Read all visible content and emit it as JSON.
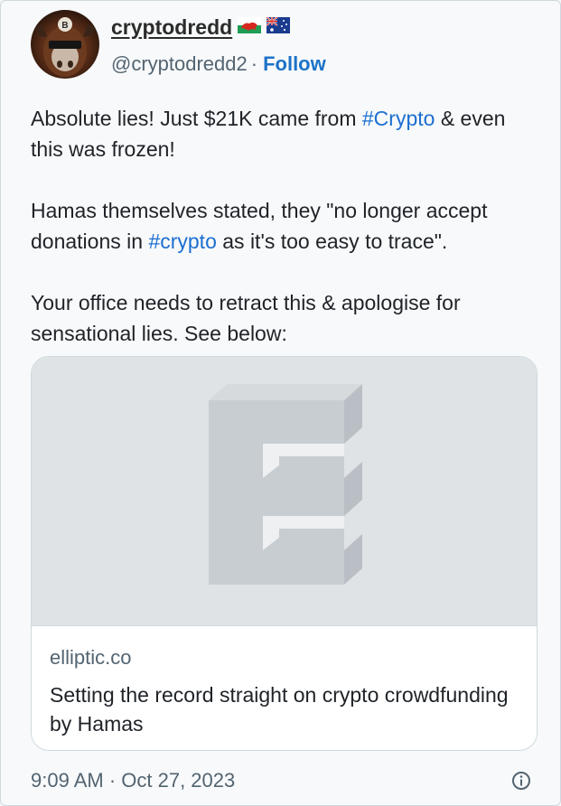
{
  "author": {
    "display_name": "cryptodredd",
    "handle": "@cryptodredd2",
    "separator": "·",
    "follow_label": "Follow",
    "flags": [
      "wales-flag-icon",
      "australia-flag-icon"
    ]
  },
  "tweet": {
    "p1_a": "Absolute lies!  Just $21K came from ",
    "p1_tag": "#Crypto",
    "p1_b": " & even this was frozen!",
    "p2_a": "Hamas themselves stated, they \"no longer accept donations in ",
    "p2_tag": "#crypto",
    "p2_b": " as it's too easy to trace\".",
    "p3": "Your office needs to retract this & apologise for sensational lies. See below:"
  },
  "card": {
    "domain": "elliptic.co",
    "title": "Setting the record straight on crypto crowdfunding by Hamas",
    "image_icon": "elliptic-logo-icon"
  },
  "timestamp": "9:09 AM · Oct 27, 2023",
  "colors": {
    "link": "#1d6fd1",
    "follow": "#1d72c7",
    "muted": "#536471",
    "card_image_bg": "#dfe3e6"
  }
}
